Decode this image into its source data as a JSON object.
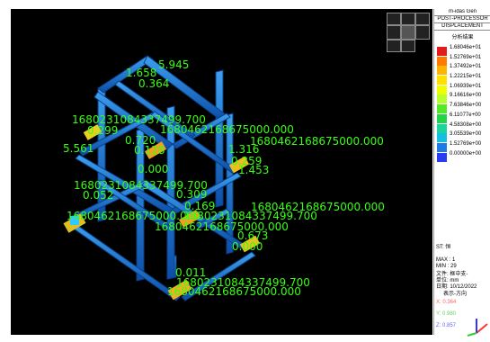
{
  "panel": {
    "title_line1": "m-idas Gen",
    "title_line2": "POST-PROCESSOR",
    "title_line3": "DISPLACEMENT",
    "legend_heading": "分析结果",
    "legend_values": [
      "1.68046e+01",
      "1.52769e+01",
      "1.37492e+01",
      "1.22215e+01",
      "1.06939e+01",
      "9.16616e+00",
      "7.63846e+00",
      "6.11077e+00",
      "4.58308e+00",
      "3.05539e+00",
      "1.52769e+00",
      "0.00000e+00"
    ],
    "legend_colors": [
      "#e21b1b",
      "#ff7a00",
      "#ffb400",
      "#ffe000",
      "#f0ff00",
      "#b8ff30",
      "#55e828",
      "#23d44a",
      "#1cd59e",
      "#16bfe0",
      "#1d7be6",
      "#2a3cf0"
    ],
    "st": "ST: 恒",
    "max": "MAX : 1",
    "min": "MIN : 29",
    "file": "文件: 框中支-",
    "unit": "单位: mm",
    "date": "日期: 10/12/2022",
    "view": "表示-方向",
    "x": "X: 0.364",
    "y": "Y: 0.980",
    "z": "Z: 0.857"
  },
  "labels": [
    {
      "text": "5.945"
    },
    {
      "text": "1.6​58"
    },
    {
      "text": "0.364"
    },
    {
      "text": "1680231084337499.700"
    },
    {
      "text": "0.299"
    },
    {
      "text": "1680462168675000.000"
    },
    {
      "text": "0.720"
    },
    {
      "text": "0.128"
    },
    {
      "text": "5.561"
    },
    {
      "text": "1.3​16"
    },
    {
      "text": "1680462168675000.000"
    },
    {
      "text": "0.259"
    },
    {
      "text": "1.453"
    },
    {
      "text": "0.000"
    },
    {
      "text": "1680231084337499.700"
    },
    {
      "text": "0.052"
    },
    {
      "text": "0.309"
    },
    {
      "text": "0.169"
    },
    {
      "text": "1680462168675000.000"
    },
    {
      "text": "1680462168675000.000"
    },
    {
      "text": "1680231084337499.700"
    },
    {
      "text": "1680462168675000.000"
    },
    {
      "text": "0.673"
    },
    {
      "text": "0.000"
    },
    {
      "text": "0.011"
    },
    {
      "text": "1680231084337499.700"
    },
    {
      "text": "1680462168675000.000"
    }
  ]
}
